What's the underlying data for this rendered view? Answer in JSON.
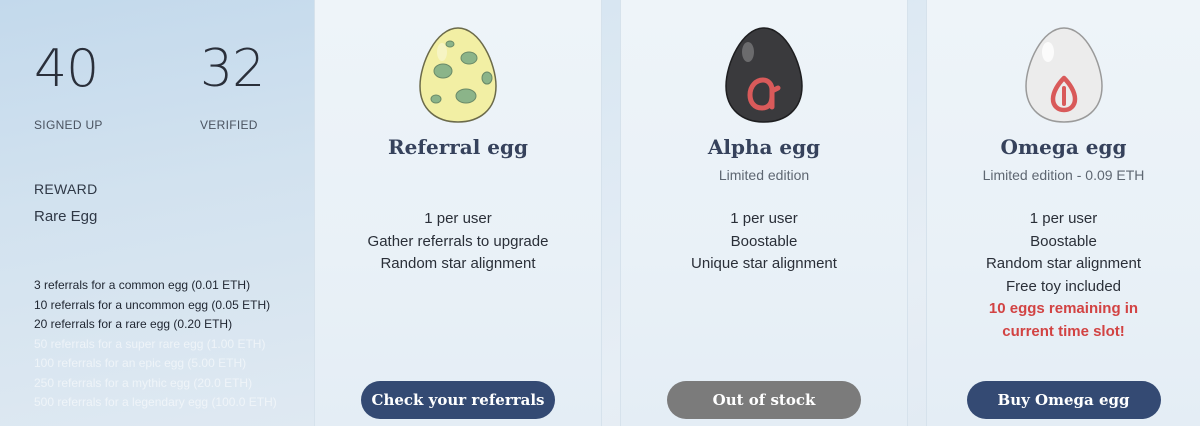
{
  "stats": {
    "signed_up": {
      "value": "40",
      "label": "SIGNED UP"
    },
    "verified": {
      "value": "32",
      "label": "VERIFIED"
    }
  },
  "reward": {
    "heading": "REWARD",
    "value": "Rare Egg",
    "tiers": [
      {
        "text": "3 referrals for a common egg (0.01 ETH)",
        "unlocked": true
      },
      {
        "text": "10 referrals for a uncommon egg (0.05 ETH)",
        "unlocked": true
      },
      {
        "text": "20 referrals for a rare egg (0.20 ETH)",
        "unlocked": true
      },
      {
        "text": "50 referrals for a super rare egg (1.00 ETH)",
        "unlocked": false
      },
      {
        "text": "100 referrals for an epic egg (5.00 ETH)",
        "unlocked": false
      },
      {
        "text": "250 referrals for a mythic egg (20.0 ETH)",
        "unlocked": false
      },
      {
        "text": "500 referrals for a legendary egg (100.0 ETH)",
        "unlocked": false
      }
    ]
  },
  "cards": [
    {
      "title": "Referral egg",
      "subtitle": "",
      "egg": {
        "icon": "spotted-yellow-egg-icon",
        "shell": "#f2efa4",
        "spots": "#8bb489"
      },
      "features": [
        "1 per user",
        "Gather referrals to upgrade",
        "Random star alignment"
      ],
      "alerts": [],
      "button": {
        "label": "Check your referrals",
        "enabled": true
      }
    },
    {
      "title": "Alpha egg",
      "subtitle": "Limited edition",
      "egg": {
        "icon": "alpha-egg-icon",
        "shell": "#3a3a3d",
        "glyph": "#d95a5a"
      },
      "features": [
        "1 per user",
        "Boostable",
        "Unique star alignment"
      ],
      "alerts": [],
      "button": {
        "label": "Out of stock",
        "enabled": false
      }
    },
    {
      "title": "Omega egg",
      "subtitle": "Limited edition - 0.09 ETH",
      "egg": {
        "icon": "omega-egg-icon",
        "shell": "#ececec",
        "glyph": "#d95a5a"
      },
      "features": [
        "1 per user",
        "Boostable",
        "Random star alignment",
        "Free toy included"
      ],
      "alerts": [
        "10 eggs remaining in",
        "current time slot!"
      ],
      "button": {
        "label": "Buy Omega egg",
        "enabled": true
      }
    }
  ],
  "colors": {
    "button_primary": "#344a73",
    "button_disabled": "#7b7b7b",
    "alert_text": "#d24343",
    "title_text": "#36425c"
  }
}
